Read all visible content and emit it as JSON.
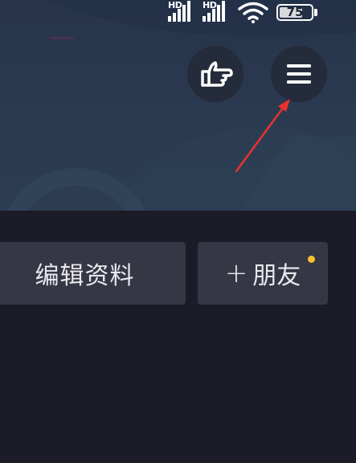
{
  "status_bar": {
    "sim1_label": "HD",
    "sim2_label": "HD",
    "battery_level": "75",
    "icons": [
      "hd-signal-icon",
      "hd-signal-icon",
      "wifi-icon",
      "battery-icon"
    ]
  },
  "header": {
    "gesture_icon": "pointing-hand-icon",
    "menu_icon": "hamburger-menu-icon"
  },
  "actions": {
    "edit_profile_label": "编辑资料",
    "add_friend_plus": "+",
    "add_friend_label": "朋友"
  },
  "colors": {
    "background": "#1b1c27",
    "button_bg": "#363744",
    "notification_dot": "#f5c12e",
    "annotation_arrow": "#e8332c"
  }
}
